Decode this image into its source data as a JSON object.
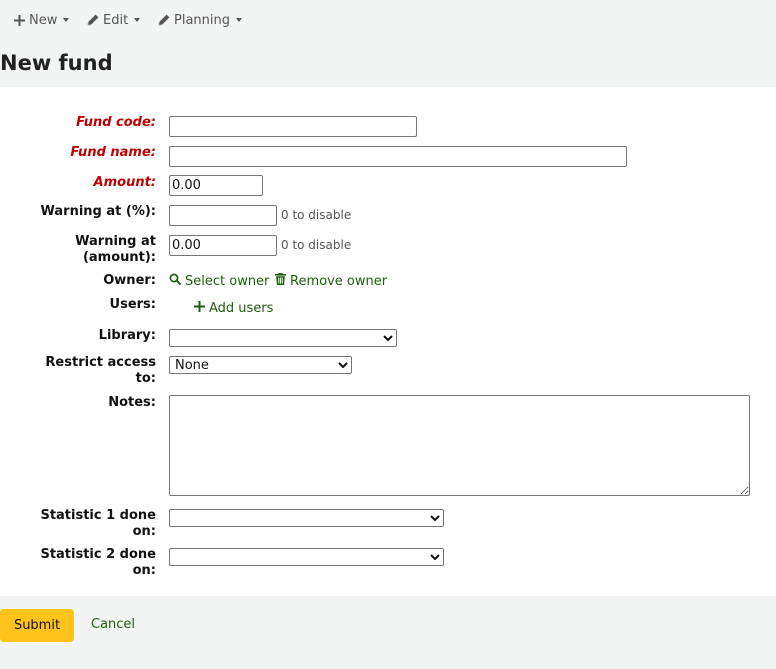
{
  "toolbar": {
    "new_label": "New",
    "edit_label": "Edit",
    "planning_label": "Planning"
  },
  "page": {
    "title": "New fund"
  },
  "form": {
    "fund_code": {
      "label": "Fund code:",
      "value": ""
    },
    "fund_name": {
      "label": "Fund name:",
      "value": ""
    },
    "amount": {
      "label": "Amount:",
      "value": "0.00"
    },
    "warning_percent": {
      "label": "Warning at (%):",
      "value": "",
      "hint": "0 to disable"
    },
    "warning_amount": {
      "label_line1": "Warning at",
      "label_line2": "(amount):",
      "value": "0.00",
      "hint": "0 to disable"
    },
    "owner": {
      "label": "Owner:",
      "select_label": "Select owner",
      "remove_label": "Remove owner"
    },
    "users": {
      "label": "Users:",
      "add_label": "Add users"
    },
    "library": {
      "label": "Library:",
      "selected": ""
    },
    "restrict": {
      "label_line1": "Restrict access",
      "label_line2": "to:",
      "selected": "None"
    },
    "notes": {
      "label": "Notes:",
      "value": ""
    },
    "statistic1": {
      "label_line1": "Statistic 1 done",
      "label_line2": "on:",
      "selected": ""
    },
    "statistic2": {
      "label_line1": "Statistic 2 done",
      "label_line2": "on:",
      "selected": ""
    }
  },
  "actions": {
    "submit_label": "Submit",
    "cancel_label": "Cancel"
  },
  "colors": {
    "required": "#c00000",
    "link": "#1c5f0c",
    "submit_bg": "#ffc31b",
    "page_bg": "#f3f4f4"
  },
  "icons": [
    "plus-icon",
    "pencil-icon",
    "search-icon",
    "trash-icon"
  ]
}
